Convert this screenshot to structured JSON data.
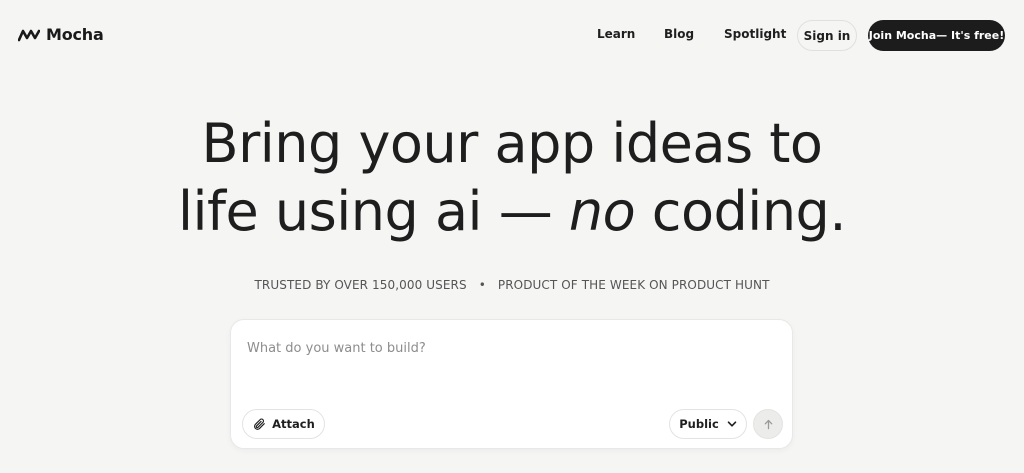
{
  "brand": {
    "name": "Mocha",
    "icon": "mocha-logo-icon"
  },
  "nav": {
    "learn": "Learn",
    "blog": "Blog",
    "spotlight": "Spotlight",
    "sign_in": "Sign in",
    "join": "Join Mocha— It's free!"
  },
  "hero": {
    "line1": "Bring your app ideas to",
    "line2_start": "life using ai — ",
    "line2_em": "no",
    "line2_end": " coding."
  },
  "trust": {
    "users": "TRUSTED BY OVER 150,000 USERS",
    "separator": "•",
    "award": "PRODUCT OF THE WEEK ON PRODUCT HUNT"
  },
  "prompt": {
    "placeholder": "What do you want to build?",
    "value": "",
    "attach_label": "Attach",
    "attach_icon": "paperclip-icon",
    "visibility_label": "Public",
    "visibility_icon": "chevron-down-icon",
    "send_icon": "arrow-up-icon"
  },
  "colors": {
    "background": "#f5f5f4",
    "primary_button": "#1c1c1c",
    "card": "#ffffff",
    "send_disabled": "#ececea"
  }
}
